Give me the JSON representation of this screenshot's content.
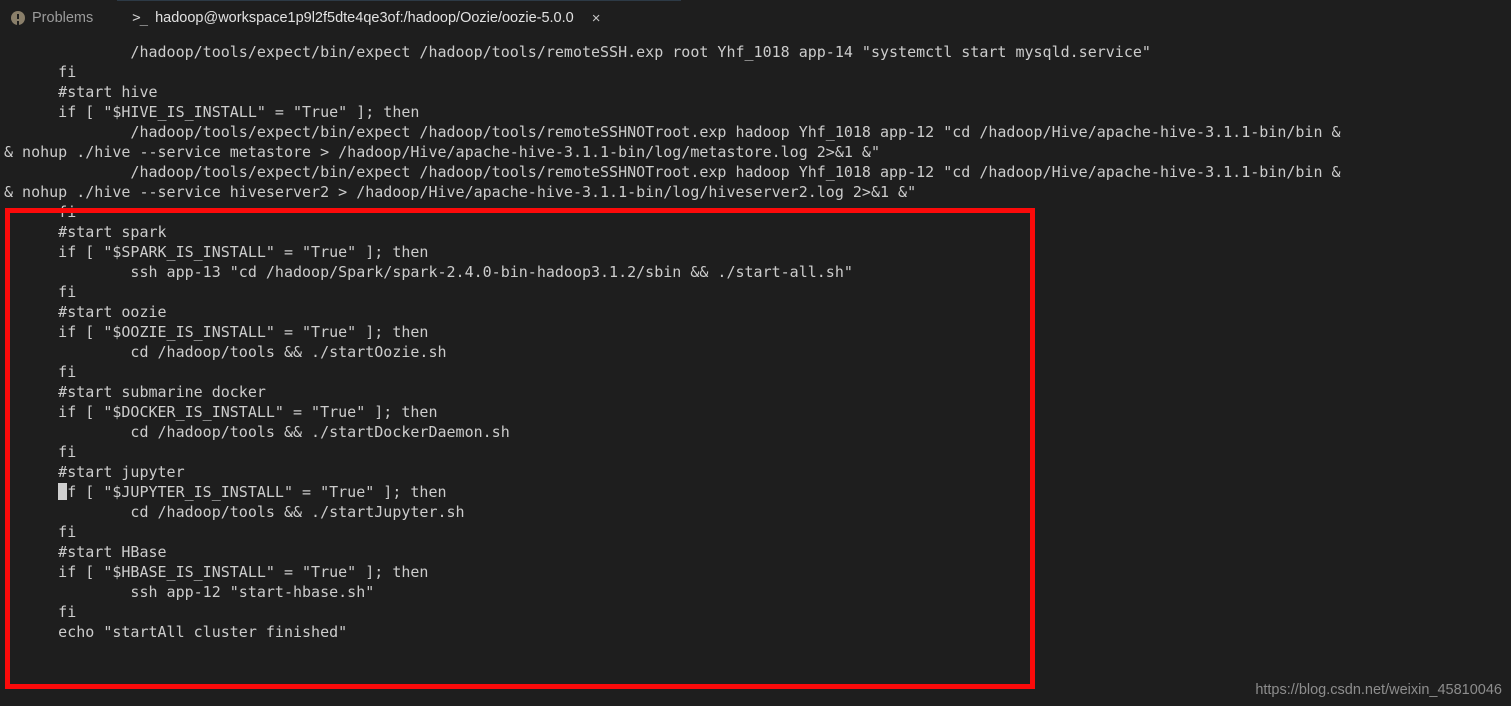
{
  "panel": {
    "problems_tab": {
      "label": "Problems",
      "icon": "warning-circle-icon"
    },
    "terminal_tab": {
      "prompt_glyph": ">_",
      "label": "hadoop@workspace1p9l2f5dte4qe3of:/hadoop/Oozie/oozie-5.0.0",
      "close_glyph": "×"
    }
  },
  "terminal": {
    "background_color": "#1e1e1e",
    "foreground_color": "#cccccc",
    "lines": [
      "              /hadoop/tools/expect/bin/expect /hadoop/tools/remoteSSH.exp root Yhf_1018 app-14 \"systemctl start mysqld.service\"",
      "      fi",
      "      #start hive",
      "      if [ \"$HIVE_IS_INSTALL\" = \"True\" ]; then",
      "              /hadoop/tools/expect/bin/expect /hadoop/tools/remoteSSHNOTroot.exp hadoop Yhf_1018 app-12 \"cd /hadoop/Hive/apache-hive-3.1.1-bin/bin &",
      "& nohup ./hive --service metastore > /hadoop/Hive/apache-hive-3.1.1-bin/log/metastore.log 2>&1 &\"",
      "              /hadoop/tools/expect/bin/expect /hadoop/tools/remoteSSHNOTroot.exp hadoop Yhf_1018 app-12 \"cd /hadoop/Hive/apache-hive-3.1.1-bin/bin &",
      "& nohup ./hive --service hiveserver2 > /hadoop/Hive/apache-hive-3.1.1-bin/log/hiveserver2.log 2>&1 &\"",
      "      fi",
      "      #start spark",
      "      if [ \"$SPARK_IS_INSTALL\" = \"True\" ]; then",
      "              ssh app-13 \"cd /hadoop/Spark/spark-2.4.0-bin-hadoop3.1.2/sbin && ./start-all.sh\"",
      "      fi",
      "      #start oozie",
      "      if [ \"$OOZIE_IS_INSTALL\" = \"True\" ]; then",
      "              cd /hadoop/tools && ./startOozie.sh",
      "      fi",
      "      #start submarine docker",
      "      if [ \"$DOCKER_IS_INSTALL\" = \"True\" ]; then",
      "              cd /hadoop/tools && ./startDockerDaemon.sh",
      "      fi",
      "      #start jupyter",
      "CURSOR      if [ \"$JUPYTER_IS_INSTALL\" = \"True\" ]; then",
      "              cd /hadoop/tools && ./startJupyter.sh",
      "      fi",
      "      #start HBase",
      "      if [ \"$HBASE_IS_INSTALL\" = \"True\" ]; then",
      "              ssh app-12 \"start-hbase.sh\"",
      "      fi",
      "      echo \"startAll cluster finished\""
    ],
    "cursor_line_index": 22,
    "cursor_column": 6
  },
  "annotation": {
    "highlight_rect_color": "#fb0a0a"
  },
  "watermark": {
    "text": "https://blog.csdn.net/weixin_45810046"
  }
}
